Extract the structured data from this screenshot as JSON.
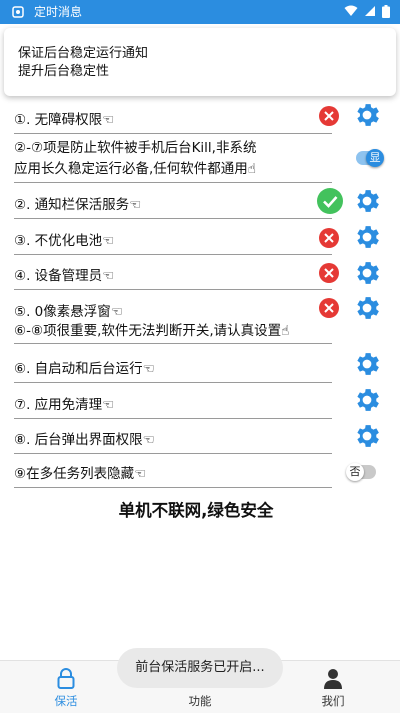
{
  "status_bar": {
    "title": "定时消息",
    "accent": "#2b8de0"
  },
  "notification": {
    "line1": "保证后台稳定运行通知",
    "line2": "提升后台稳定性"
  },
  "rows": [
    {
      "text": "①. 无障碍权限☜",
      "status": "off"
    },
    {
      "text": "②-⑦项是防止软件被手机后台Kill,非系统",
      "text2": "应用长久稳定运行必备,任何软件都通用☝",
      "toggle_label": "显",
      "toggle_on": true
    },
    {
      "text": "②. 通知栏保活服务☜",
      "status": "on"
    },
    {
      "text": "③. 不优化电池☜",
      "status": "off"
    },
    {
      "text": "④. 设备管理员☜",
      "status": "off"
    },
    {
      "text": "⑤. 0像素悬浮窗☜",
      "text2": "⑥-⑧项很重要,软件无法判断开关,请认真设置☝",
      "status": "off"
    },
    {
      "text": "⑥. 自启动和后台运行☜"
    },
    {
      "text": "⑦. 应用免清理☜"
    },
    {
      "text": "⑧. 后台弹出界面权限☜"
    },
    {
      "text": "⑨在多任务列表隐藏☜",
      "toggle_label": "否",
      "toggle_on": false
    }
  ],
  "slogan": "单机不联网,绿色安全",
  "toast": "前台保活服务已开启...",
  "nav": [
    {
      "label": "保活",
      "icon": "lock-icon",
      "active": true
    },
    {
      "label": "功能",
      "icon": "grid-icon",
      "active": false
    },
    {
      "label": "我们",
      "icon": "user-icon",
      "active": false
    }
  ],
  "colors": {
    "gear": "#2b8de0",
    "error": "#e53935",
    "ok": "#43c25d",
    "active_nav": "#2b8de0"
  }
}
